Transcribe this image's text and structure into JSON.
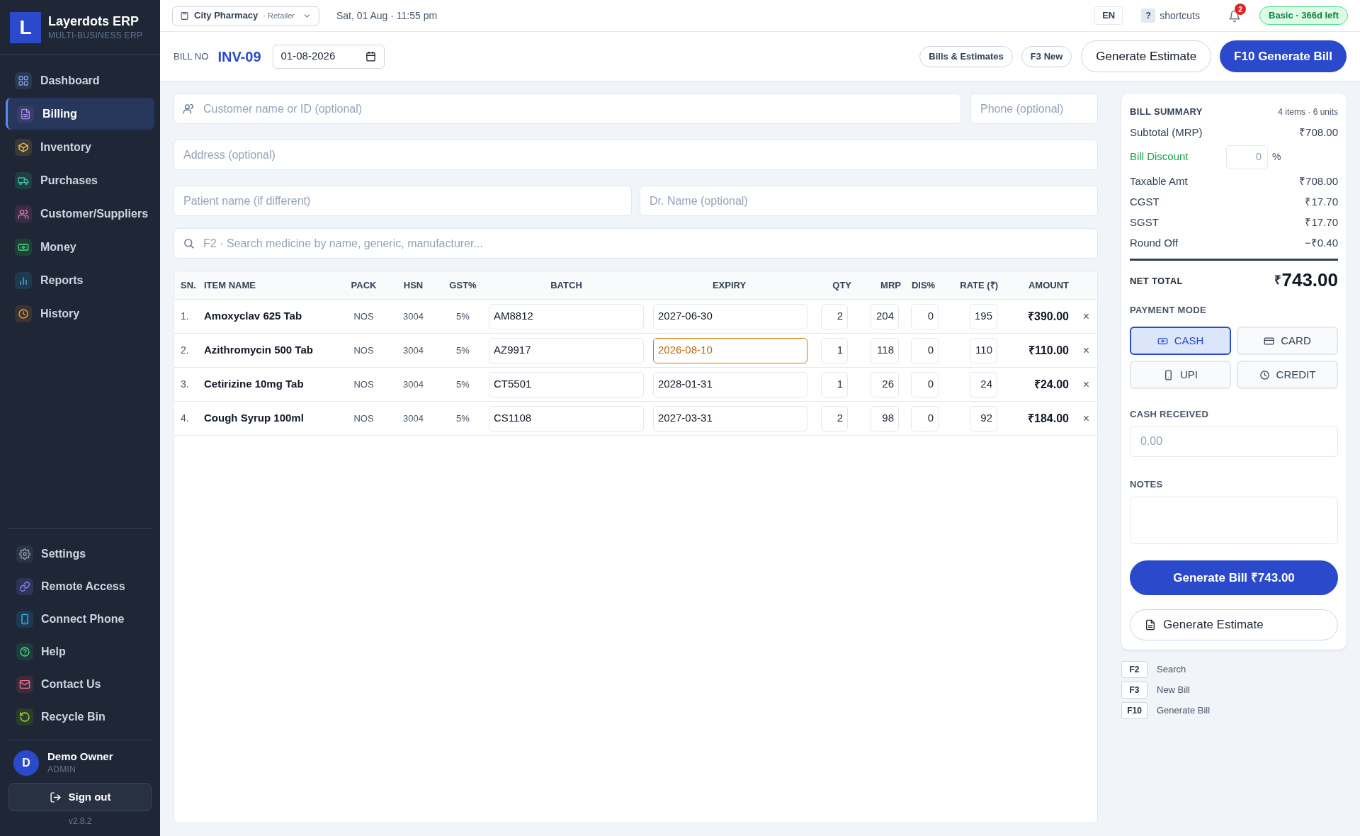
{
  "brand": {
    "logo": "L",
    "name": "Layerdots ERP",
    "tagline": "MULTI-BUSINESS ERP"
  },
  "sidebar": {
    "items": [
      {
        "label": "Dashboard",
        "selected": false
      },
      {
        "label": "Billing",
        "selected": true
      },
      {
        "label": "Inventory",
        "selected": false
      },
      {
        "label": "Purchases",
        "selected": false
      },
      {
        "label": "Customer/Suppliers",
        "selected": false
      },
      {
        "label": "Money",
        "selected": false
      },
      {
        "label": "Reports",
        "selected": false
      },
      {
        "label": "History",
        "selected": false
      }
    ],
    "bottom_items": [
      {
        "label": "Settings"
      },
      {
        "label": "Remote Access"
      },
      {
        "label": "Connect Phone"
      },
      {
        "label": "Help"
      },
      {
        "label": "Contact Us"
      },
      {
        "label": "Recycle Bin"
      }
    ],
    "user": {
      "initial": "D",
      "name": "Demo Owner",
      "role": "ADMIN"
    },
    "sign_out": "Sign out",
    "version": "v2.8.2"
  },
  "topbar": {
    "store": "City Pharmacy",
    "store_type": "· Retailer",
    "datetime": "Sat, 01 Aug · 11:55 pm",
    "language": "EN",
    "shortcuts_key": "?",
    "shortcuts_label": "shortcuts",
    "notifications": "2",
    "plan": "Basic · 366d left"
  },
  "bill_header": {
    "bill_no_label": "BILL NO",
    "bill_no": "INV-09",
    "date": "01-08-2026",
    "buttons": [
      {
        "label": "Bills & Estimates",
        "kind": "small"
      },
      {
        "label": "F3 New",
        "kind": "small"
      },
      {
        "label": "Generate Estimate",
        "kind": "outline"
      },
      {
        "label": "F10 Generate Bill",
        "kind": "primary"
      }
    ]
  },
  "form": {
    "customer_placeholder": "Customer name or ID (optional)",
    "phone_placeholder": "Phone (optional)",
    "address_placeholder": "Address (optional)",
    "patient_placeholder": "Patient name (if different)",
    "doctor_placeholder": "Dr. Name (optional)",
    "search_placeholder": "F2 · Search medicine by name, generic, manufacturer..."
  },
  "table": {
    "columns": [
      "SN.",
      "ITEM NAME",
      "PACK",
      "HSN",
      "GST%",
      "BATCH",
      "EXPIRY",
      "QTY",
      "MRP",
      "DIS%",
      "RATE (₹)",
      "AMOUNT"
    ],
    "rows": [
      {
        "sn": "1.",
        "item": "Amoxyclav 625 Tab",
        "pack": "NOS",
        "hsn": "3004",
        "gst": "5%",
        "batch": "AM8812",
        "expiry": "2027-06-30",
        "expiry_warning": false,
        "qty": "2",
        "mrp": "204",
        "dis": "0",
        "rate": "195",
        "amount": "₹390.00",
        "remove": "×"
      },
      {
        "sn": "2.",
        "item": "Azithromycin 500 Tab",
        "pack": "NOS",
        "hsn": "3004",
        "gst": "5%",
        "batch": "AZ9917",
        "expiry": "2026-08-10",
        "expiry_warning": true,
        "qty": "1",
        "mrp": "118",
        "dis": "0",
        "rate": "110",
        "amount": "₹110.00",
        "remove": "×"
      },
      {
        "sn": "3.",
        "item": "Cetirizine 10mg Tab",
        "pack": "NOS",
        "hsn": "3004",
        "gst": "5%",
        "batch": "CT5501",
        "expiry": "2028-01-31",
        "expiry_warning": false,
        "qty": "1",
        "mrp": "26",
        "dis": "0",
        "rate": "24",
        "amount": "₹24.00",
        "remove": "×"
      },
      {
        "sn": "4.",
        "item": "Cough Syrup 100ml",
        "pack": "NOS",
        "hsn": "3004",
        "gst": "5%",
        "batch": "CS1108",
        "expiry": "2027-03-31",
        "expiry_warning": false,
        "qty": "2",
        "mrp": "98",
        "dis": "0",
        "rate": "92",
        "amount": "₹184.00",
        "remove": "×"
      }
    ]
  },
  "summary": {
    "title": "BILL SUMMARY",
    "counts": "4 items · 6 units",
    "lines": [
      {
        "kind": "amount",
        "label": "Subtotal (MRP)",
        "value": "₹708.00"
      },
      {
        "kind": "discount",
        "label": "Bill Discount",
        "value": "0",
        "unit": "%"
      },
      {
        "kind": "amount",
        "label": "Taxable Amt",
        "value": "₹708.00"
      },
      {
        "kind": "amount",
        "label": "CGST",
        "value": "₹17.70"
      },
      {
        "kind": "amount",
        "label": "SGST",
        "value": "₹17.70"
      },
      {
        "kind": "amount",
        "label": "Round Off",
        "value": "−₹0.40"
      }
    ],
    "net_total_label": "NET TOTAL",
    "net_total_currency": "₹",
    "net_total_value": "743.00",
    "payment_mode_label": "PAYMENT MODE",
    "payment_modes": [
      {
        "label": "CASH",
        "selected": true
      },
      {
        "label": "CARD",
        "selected": false
      },
      {
        "label": "UPI",
        "selected": false
      },
      {
        "label": "CREDIT",
        "selected": false
      }
    ],
    "cash_received_label": "CASH RECEIVED",
    "cash_received_placeholder": "0.00",
    "notes_label": "NOTES",
    "generate_bill": "Generate Bill ₹743.00",
    "generate_estimate": "Generate Estimate"
  },
  "shortcuts": [
    {
      "key": "F2",
      "label": "Search"
    },
    {
      "key": "F3",
      "label": "New Bill"
    },
    {
      "key": "F10",
      "label": "Generate Bill"
    }
  ]
}
